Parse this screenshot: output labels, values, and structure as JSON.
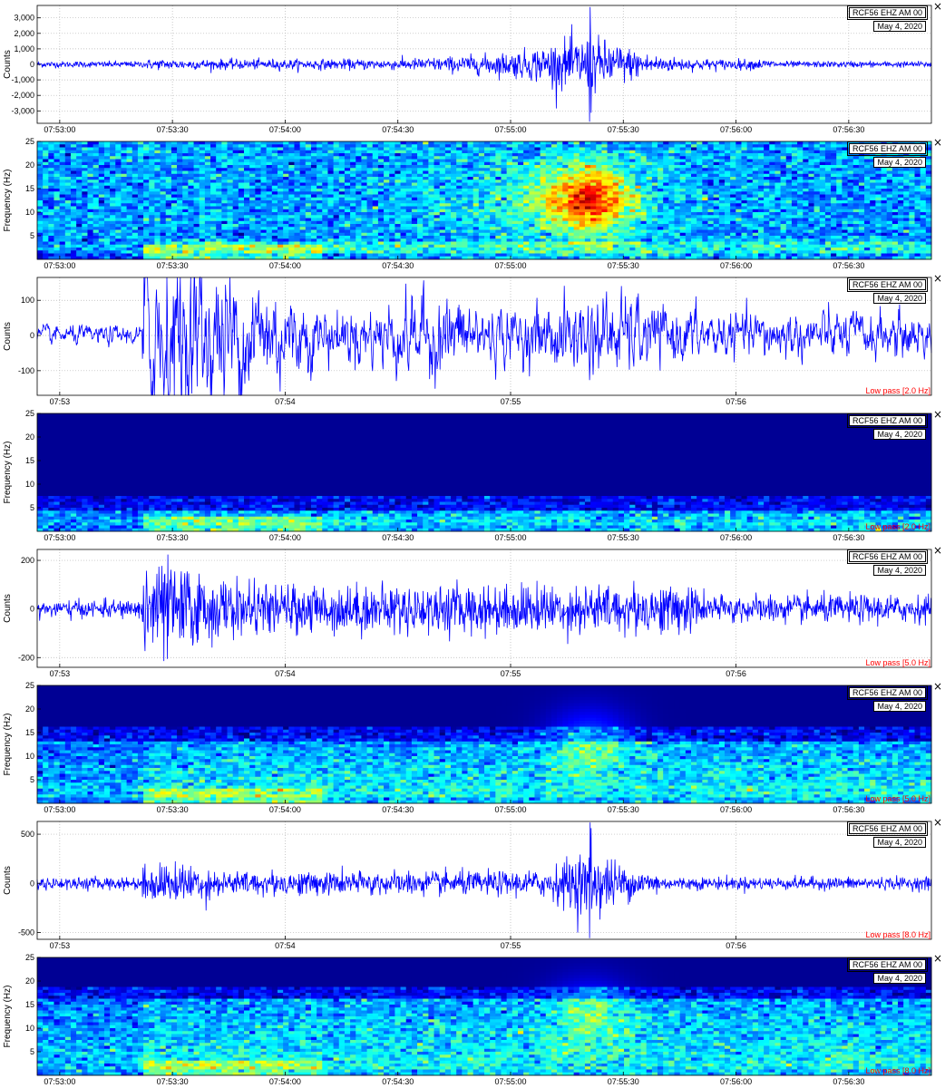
{
  "station_label": "RCF56 EHZ AM 00",
  "date_label": "May 4, 2020",
  "panels": [
    {
      "type": "wave",
      "ylabel": "Counts",
      "yticks": [
        "3,000",
        "2,000",
        "1,000",
        "0",
        "-1,000",
        "-2,000",
        "-3,000"
      ],
      "ytick_values": [
        3000,
        2000,
        1000,
        0,
        -1000,
        -2000,
        -3000
      ],
      "ylim": [
        -3800,
        3800
      ],
      "xticks": [
        "07:53:00",
        "07:53:30",
        "07:54:00",
        "07:54:30",
        "07:55:00",
        "07:55:30",
        "07:56:00",
        "07:56:30"
      ],
      "xtick_seconds": [
        0,
        30,
        60,
        90,
        120,
        150,
        180,
        210
      ],
      "filter": ""
    },
    {
      "type": "spec",
      "ylabel": "Frequency (Hz)",
      "yticks": [
        "25",
        "20",
        "15",
        "10",
        "5"
      ],
      "ytick_values": [
        25,
        20,
        15,
        10,
        5
      ],
      "ylim": [
        0,
        25
      ],
      "xticks": [
        "07:53:00",
        "07:53:30",
        "07:54:00",
        "07:54:30",
        "07:55:00",
        "07:55:30",
        "07:56:00",
        "07:56:30"
      ],
      "xtick_seconds": [
        0,
        30,
        60,
        90,
        120,
        150,
        180,
        210
      ],
      "filter": ""
    },
    {
      "type": "wave",
      "ylabel": "Counts",
      "yticks": [
        "100",
        "0",
        "-100"
      ],
      "ytick_values": [
        100,
        0,
        -100
      ],
      "ylim": [
        -170,
        165
      ],
      "xticks": [
        "07:53",
        "07:54",
        "07:55",
        "07:56"
      ],
      "xtick_seconds": [
        0,
        60,
        120,
        180
      ],
      "filter": "Low pass [2.0 Hz]"
    },
    {
      "type": "spec",
      "ylabel": "Frequency (Hz)",
      "yticks": [
        "25",
        "20",
        "15",
        "10",
        "5"
      ],
      "ytick_values": [
        25,
        20,
        15,
        10,
        5
      ],
      "ylim": [
        0,
        25
      ],
      "xticks": [
        "07:53:00",
        "07:53:30",
        "07:54:00",
        "07:54:30",
        "07:55:00",
        "07:55:30",
        "07:56:00",
        "07:56:30"
      ],
      "xtick_seconds": [
        0,
        30,
        60,
        90,
        120,
        150,
        180,
        210
      ],
      "filter": "Low pass [2.0 Hz]"
    },
    {
      "type": "wave",
      "ylabel": "Counts",
      "yticks": [
        "200",
        "0",
        "-200"
      ],
      "ytick_values": [
        200,
        0,
        -200
      ],
      "ylim": [
        -240,
        245
      ],
      "xticks": [
        "07:53",
        "07:54",
        "07:55",
        "07:56"
      ],
      "xtick_seconds": [
        0,
        60,
        120,
        180
      ],
      "filter": "Low pass [5.0 Hz]"
    },
    {
      "type": "spec",
      "ylabel": "Frequency (Hz)",
      "yticks": [
        "25",
        "20",
        "15",
        "10",
        "5"
      ],
      "ytick_values": [
        25,
        20,
        15,
        10,
        5
      ],
      "ylim": [
        0,
        25
      ],
      "xticks": [
        "07:53:00",
        "07:53:30",
        "07:54:00",
        "07:54:30",
        "07:55:00",
        "07:55:30",
        "07:56:00",
        "07:56:30"
      ],
      "xtick_seconds": [
        0,
        30,
        60,
        90,
        120,
        150,
        180,
        210
      ],
      "filter": "Low pass [5.0 Hz]"
    },
    {
      "type": "wave",
      "ylabel": "Counts",
      "yticks": [
        "500",
        "0",
        "-500"
      ],
      "ytick_values": [
        500,
        0,
        -500
      ],
      "ylim": [
        -570,
        630
      ],
      "xticks": [
        "07:53",
        "07:54",
        "07:55",
        "07:56"
      ],
      "xtick_seconds": [
        0,
        60,
        120,
        180
      ],
      "filter": "Low pass [8.0 Hz]"
    },
    {
      "type": "spec",
      "ylabel": "Frequency (Hz)",
      "yticks": [
        "25",
        "20",
        "15",
        "10",
        "5"
      ],
      "ytick_values": [
        25,
        20,
        15,
        10,
        5
      ],
      "ylim": [
        0,
        25
      ],
      "xticks": [
        "07:53:00",
        "07:53:30",
        "07:54:00",
        "07:54:30",
        "07:55:00",
        "07:55:30",
        "07:56:00",
        "07:56:30"
      ],
      "xtick_seconds": [
        0,
        30,
        60,
        90,
        120,
        150,
        180,
        210
      ],
      "filter": "Low pass [8.0 Hz]"
    }
  ],
  "chart_data": [
    {
      "type": "line",
      "title": "",
      "ylabel": "Counts",
      "x_range_seconds": [
        -6,
        232
      ],
      "ylim": [
        -3800,
        3800
      ],
      "grid": true,
      "series": [
        {
          "events": [
            {
              "time": "07:55:22",
              "peak_counts": 3700
            }
          ],
          "background_counts": 150,
          "window_amplitude_counts": 900
        }
      ]
    },
    {
      "type": "heatmap",
      "title": "",
      "ylabel": "Frequency (Hz)",
      "ylim": [
        0,
        25
      ],
      "colormap": "jet",
      "features": [
        {
          "time": "07:55:22",
          "freq_hz": [
            5,
            22
          ],
          "peak_freq_hz": 13
        }
      ]
    },
    {
      "type": "line",
      "title": "",
      "ylabel": "Counts",
      "ylim": [
        -170,
        165
      ],
      "filter": "Low pass [2.0 Hz]",
      "series": [
        {
          "onset": "07:53:24",
          "peak_counts": 150,
          "min_counts": -165
        }
      ]
    },
    {
      "type": "heatmap",
      "title": "",
      "ylabel": "Frequency (Hz)",
      "ylim": [
        0,
        25
      ],
      "filter": "Low pass [2.0 Hz]",
      "features": [
        {
          "freq_hz": [
            0,
            5
          ]
        }
      ]
    },
    {
      "type": "line",
      "title": "",
      "ylabel": "Counts",
      "ylim": [
        -240,
        245
      ],
      "filter": "Low pass [5.0 Hz]",
      "series": [
        {
          "onset": "07:53:24",
          "peak_counts": 240,
          "min_counts": -230
        }
      ]
    },
    {
      "type": "heatmap",
      "title": "",
      "ylabel": "Frequency (Hz)",
      "ylim": [
        0,
        25
      ],
      "filter": "Low pass [5.0 Hz]",
      "features": [
        {
          "freq_hz": [
            0,
            15
          ]
        }
      ]
    },
    {
      "type": "line",
      "title": "",
      "ylabel": "Counts",
      "ylim": [
        -570,
        630
      ],
      "filter": "Low pass [8.0 Hz]",
      "series": [
        {
          "events": [
            {
              "time": "07:55:22",
              "peak_counts": 620,
              "min_counts": -560
            }
          ]
        }
      ]
    },
    {
      "type": "heatmap",
      "title": "",
      "ylabel": "Frequency (Hz)",
      "ylim": [
        0,
        25
      ],
      "filter": "Low pass [8.0 Hz]",
      "features": [
        {
          "freq_hz": [
            0,
            18
          ]
        }
      ]
    }
  ]
}
